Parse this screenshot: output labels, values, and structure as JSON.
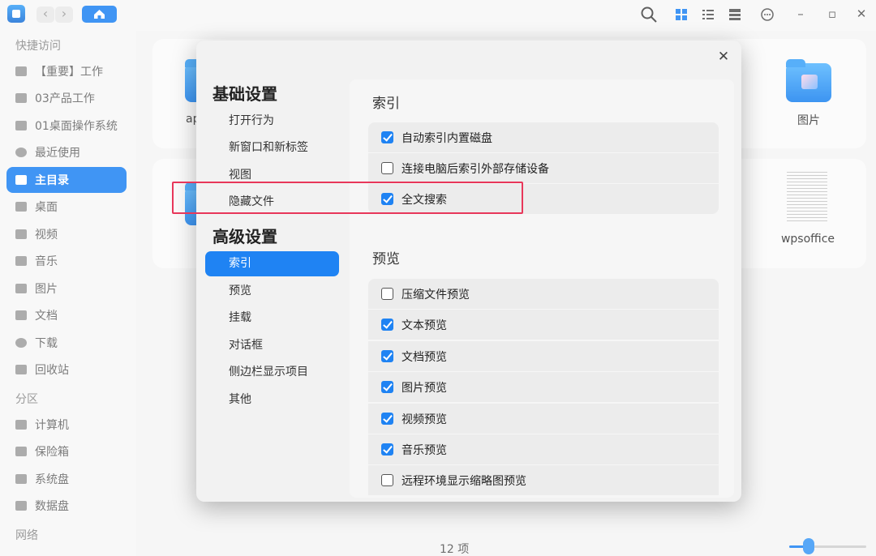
{
  "titlebar": {
    "back_icon": "chevron-left-icon",
    "forward_icon": "chevron-right-icon",
    "home_icon": "home-icon",
    "search_icon": "search-icon",
    "view_icons": [
      "grid-view-icon",
      "list-view-icon",
      "detail-view-icon"
    ],
    "menu_icon": "more-options-icon",
    "minimize": "–",
    "maximize": "▫",
    "close": "✕"
  },
  "sidebar": {
    "quick_access_heading": "快捷访问",
    "quick_items": [
      {
        "label": "【重要】工作"
      },
      {
        "label": "03产品工作"
      },
      {
        "label": "01桌面操作系统"
      },
      {
        "label": "最近使用"
      },
      {
        "label": "主目录",
        "active": true
      },
      {
        "label": "桌面"
      },
      {
        "label": "视频"
      },
      {
        "label": "音乐"
      },
      {
        "label": "图片"
      },
      {
        "label": "文档"
      },
      {
        "label": "下载"
      },
      {
        "label": "回收站"
      }
    ],
    "partition_heading": "分区",
    "partition_items": [
      {
        "label": "计算机"
      },
      {
        "label": "保险箱"
      },
      {
        "label": "系统盘"
      },
      {
        "label": "数据盘"
      }
    ],
    "network_heading": "网络"
  },
  "main": {
    "files": [
      {
        "label": "ap"
      },
      {
        "label": "图片"
      },
      {
        "label": "wpsoffice"
      }
    ],
    "status_count": "12 项",
    "accent_color": "#1f83f3"
  },
  "dialog": {
    "close_icon": "close-icon",
    "nav_group_basic": "基础设置",
    "nav_basic_items": [
      "打开行为",
      "新窗口和新标签",
      "视图",
      "隐藏文件"
    ],
    "nav_group_advanced": "高级设置",
    "nav_advanced_items": [
      "索引",
      "预览",
      "挂载",
      "对话框",
      "侧边栏显示项目",
      "其他"
    ],
    "index_section_title": "索引",
    "index_options": [
      {
        "label": "自动索引内置磁盘",
        "checked": true
      },
      {
        "label": "连接电脑后索引外部存储设备",
        "checked": false
      },
      {
        "label": "全文搜索",
        "checked": true
      }
    ],
    "preview_section_title": "预览",
    "preview_options": [
      {
        "label": "压缩文件预览",
        "checked": false
      },
      {
        "label": "文本预览",
        "checked": true
      },
      {
        "label": "文档预览",
        "checked": true
      },
      {
        "label": "图片预览",
        "checked": true
      },
      {
        "label": "视频预览",
        "checked": true
      },
      {
        "label": "音乐预览",
        "checked": true
      },
      {
        "label": "远程环境显示缩略图预览",
        "checked": false
      }
    ],
    "highlight_color": "#e8375a"
  }
}
